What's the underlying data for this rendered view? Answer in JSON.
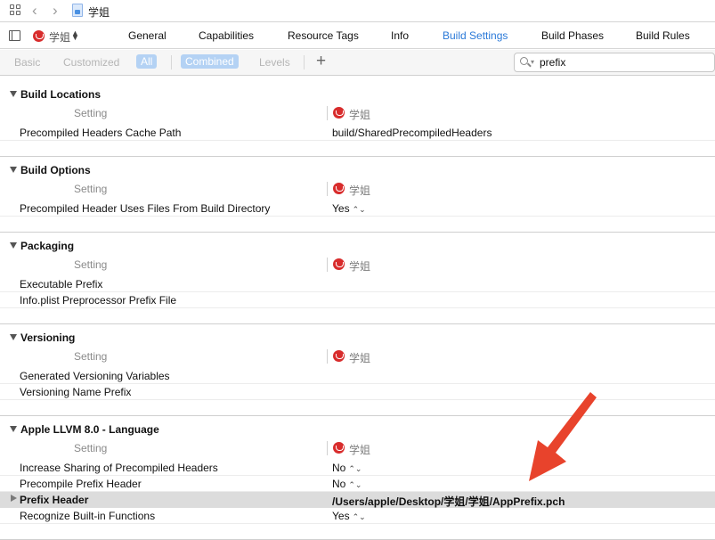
{
  "nav": {
    "file_name": "学姐"
  },
  "target": {
    "name": "学姐"
  },
  "tabs": [
    {
      "label": "General"
    },
    {
      "label": "Capabilities"
    },
    {
      "label": "Resource Tags"
    },
    {
      "label": "Info"
    },
    {
      "label": "Build Settings",
      "active": true
    },
    {
      "label": "Build Phases"
    },
    {
      "label": "Build Rules"
    }
  ],
  "filters": {
    "basic": "Basic",
    "customized": "Customized",
    "all": "All",
    "combined": "Combined",
    "levels": "Levels"
  },
  "search": {
    "value": "prefix"
  },
  "column": {
    "setting": "Setting",
    "target": "学姐"
  },
  "sections": [
    {
      "title": "Build Locations",
      "rows": [
        {
          "name": "Precompiled Headers Cache Path",
          "value": "build/SharedPrecompiledHeaders"
        }
      ]
    },
    {
      "title": "Build Options",
      "rows": [
        {
          "name": "Precompiled Header Uses Files From Build Directory",
          "value": "Yes"
        }
      ]
    },
    {
      "title": "Packaging",
      "rows": [
        {
          "name": "Executable Prefix",
          "value": ""
        },
        {
          "name": "Info.plist Preprocessor Prefix File",
          "value": ""
        }
      ]
    },
    {
      "title": "Versioning",
      "rows": [
        {
          "name": "Generated Versioning Variables",
          "value": ""
        },
        {
          "name": "Versioning Name Prefix",
          "value": ""
        }
      ]
    },
    {
      "title": "Apple LLVM 8.0 - Language",
      "rows": [
        {
          "name": "Increase Sharing of Precompiled Headers",
          "value": "No"
        },
        {
          "name": "Precompile Prefix Header",
          "value": "No"
        },
        {
          "name": "Prefix Header",
          "value": "/Users/apple/Desktop/学姐/学姐/AppPrefix.pch"
        },
        {
          "name": "Recognize Built-in Functions",
          "value": "Yes"
        }
      ]
    }
  ],
  "colors": {
    "accent": "#2a79d8",
    "badge": "#d82c2c",
    "annotation_arrow": "#e8432c",
    "selected_row": "#dcdcdc"
  }
}
